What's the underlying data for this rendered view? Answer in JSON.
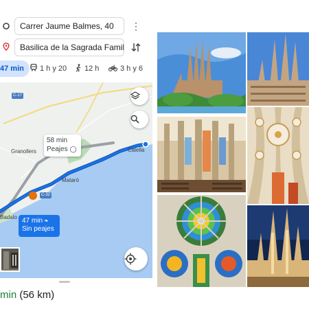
{
  "maps": {
    "origin": "Carrer Jaume Balmes, 40",
    "destination": "Basilica de la Sagrada Famil...",
    "modes": [
      {
        "label": "47 min",
        "icon": "car-icon"
      },
      {
        "label": "1 h y 20",
        "icon": "train-icon"
      },
      {
        "label": "12 h",
        "icon": "walk-icon"
      },
      {
        "label": "3 h y 6",
        "icon": "bike-icon"
      }
    ],
    "map_labels": {
      "road_c17": "C-17",
      "road_c32": "C-32",
      "granollers": "Granollers",
      "mataro": "Mataró",
      "calella": "Calella",
      "badalona": "Badalo"
    },
    "callouts": {
      "alt_time": "58 min",
      "alt_note": "Peajes",
      "main_time": "47 min",
      "main_note": "Sin peajes"
    },
    "summary": {
      "time": "min",
      "distance": "(56 km)"
    },
    "colors": {
      "route": "#1a73e8",
      "alt_route": "#9aa0a6",
      "sea": "#a7cbf2",
      "land": "#eef1ee",
      "accent": "#0b57d0"
    }
  },
  "collage": {
    "photos": [
      {
        "name": "sagrada-familia-exterior-park"
      },
      {
        "name": "nativity-facade-towers"
      },
      {
        "name": "nave-columns-interior"
      },
      {
        "name": "vaulted-ceiling-white"
      },
      {
        "name": "rose-stained-glass-window"
      },
      {
        "name": "towers-at-night"
      }
    ]
  }
}
